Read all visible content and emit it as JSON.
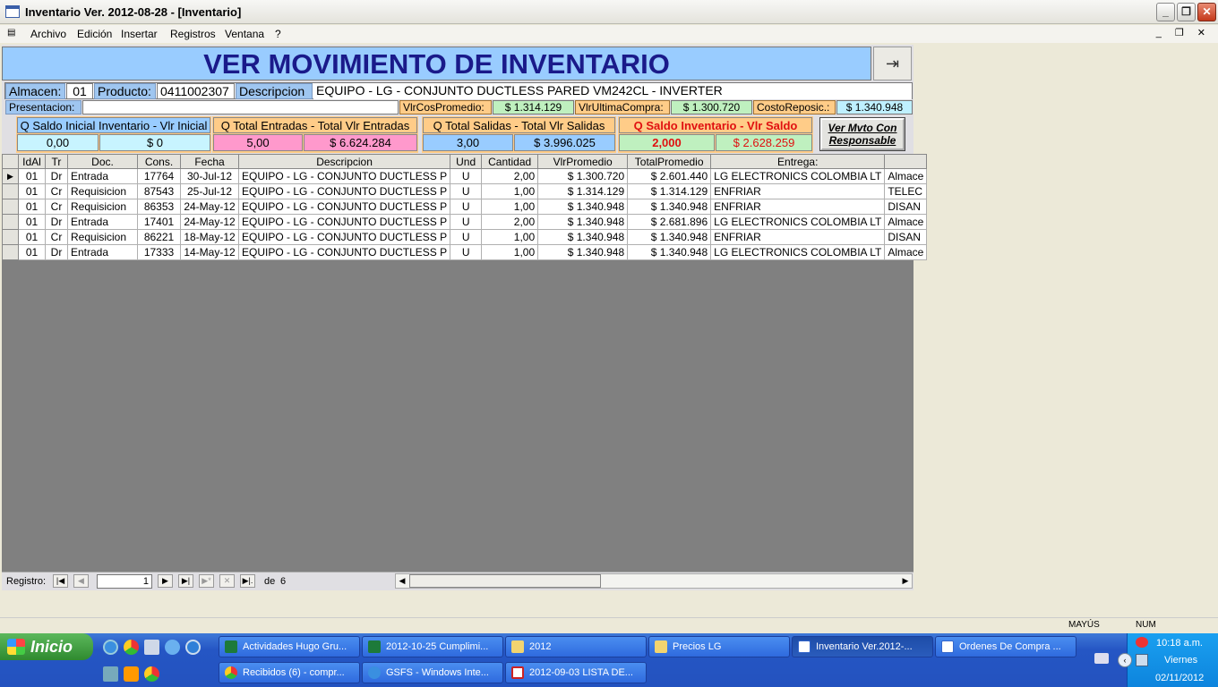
{
  "window": {
    "title": "Inventario Ver. 2012-08-28 - [Inventario]",
    "min": "_",
    "max": "❐",
    "close": "✕"
  },
  "menu": [
    "Archivo",
    "Edición",
    "Insertar",
    "Registros",
    "Ventana",
    "?"
  ],
  "form": {
    "title": "VER MOVIMIENTO DE INVENTARIO",
    "almacen_label": "Almacen:",
    "almacen_value": "01",
    "producto_label": "Producto:",
    "producto_value": "0411002307",
    "descripcion_label": "Descripcion",
    "descripcion_value": "EQUIPO - LG - CONJUNTO DUCTLESS PARED VM242CL - INVERTER",
    "presentacion_label": "Presentacion:",
    "presentacion_value": "",
    "vlrcos_label": "VlrCosPromedio:",
    "vlrcos_value": "$ 1.314.129",
    "vlrultima_label": "VlrUltimaCompra:",
    "vlrultima_value": "$ 1.300.720",
    "costo_label": "CostoReposic.:",
    "costo_value": "$ 1.340.948",
    "saldo_inicial_label": "Q Saldo Inicial Inventario - Vlr Inicial",
    "saldo_inicial_q": "0,00",
    "saldo_inicial_v": "$ 0",
    "entradas_label": "Q Total Entradas - Total Vlr Entradas",
    "entradas_q": "5,00",
    "entradas_v": "$ 6.624.284",
    "salidas_label": "Q Total Salidas - Total Vlr Salidas",
    "salidas_q": "3,00",
    "salidas_v": "$ 3.996.025",
    "saldo_label": "Q Saldo Inventario  - Vlr Saldo",
    "saldo_q": "2,000",
    "saldo_v": "$ 2.628.259",
    "ver_mvto_button": "Ver Mvto Con Responsable"
  },
  "grid": {
    "columns": [
      "IdAl",
      "Tr",
      "Doc.",
      "Cons.",
      "Fecha",
      "Descripcion",
      "Und",
      "Cantidad",
      "VlrPromedio",
      "TotalPromedio",
      "Entrega:",
      ""
    ],
    "rows": [
      [
        "01",
        "Dr",
        "Entrada",
        "17764",
        "30-Jul-12",
        "EQUIPO - LG - CONJUNTO DUCTLESS P",
        "U",
        "2,00",
        "$ 1.300.720",
        "$ 2.601.440",
        "LG ELECTRONICS COLOMBIA LT",
        "Almace"
      ],
      [
        "01",
        "Cr",
        "Requisicion",
        "87543",
        "25-Jul-12",
        "EQUIPO - LG - CONJUNTO DUCTLESS P",
        "U",
        "1,00",
        "$ 1.314.129",
        "$ 1.314.129",
        "ENFRIAR",
        "TELEC"
      ],
      [
        "01",
        "Cr",
        "Requisicion",
        "86353",
        "24-May-12",
        "EQUIPO - LG - CONJUNTO DUCTLESS P",
        "U",
        "1,00",
        "$ 1.340.948",
        "$ 1.340.948",
        "ENFRIAR",
        "DISAN"
      ],
      [
        "01",
        "Dr",
        "Entrada",
        "17401",
        "24-May-12",
        "EQUIPO - LG - CONJUNTO DUCTLESS P",
        "U",
        "2,00",
        "$ 1.340.948",
        "$ 2.681.896",
        "LG ELECTRONICS COLOMBIA LT",
        "Almace"
      ],
      [
        "01",
        "Cr",
        "Requisicion",
        "86221",
        "18-May-12",
        "EQUIPO - LG - CONJUNTO DUCTLESS P",
        "U",
        "1,00",
        "$ 1.340.948",
        "$ 1.340.948",
        "ENFRIAR",
        "DISAN"
      ],
      [
        "01",
        "Dr",
        "Entrada",
        "17333",
        "14-May-12",
        "EQUIPO - LG - CONJUNTO DUCTLESS P",
        "U",
        "1,00",
        "$ 1.340.948",
        "$ 1.340.948",
        "LG ELECTRONICS COLOMBIA LT",
        "Almace"
      ]
    ]
  },
  "navigation": {
    "label": "Registro:",
    "current": "1",
    "of_label": "de",
    "total": "6"
  },
  "status": {
    "mayus": "MAYÚS",
    "num": "NUM"
  },
  "taskbar": {
    "start": "Inicio",
    "tasks": [
      {
        "label": "Actividades Hugo Gru...",
        "icon": "excel-icon"
      },
      {
        "label": "2012-10-25 Cumplimi...",
        "icon": "excel-icon"
      },
      {
        "label": "2012",
        "icon": "folder-icon"
      },
      {
        "label": "Precios LG",
        "icon": "folder-icon"
      },
      {
        "label": "Inventario Ver.2012-...",
        "icon": "access-window-icon"
      },
      {
        "label": "Ordenes De Compra ...",
        "icon": "access-window-icon"
      },
      {
        "label": "Recibidos (6) - compr...",
        "icon": "chrome-icon"
      },
      {
        "label": "GSFS - Windows Inte...",
        "icon": "ie-icon"
      },
      {
        "label": "2012-09-03 LISTA DE...",
        "icon": "pdf-icon"
      }
    ],
    "clock_time": "10:18 a.m.",
    "clock_day": "Viernes",
    "clock_date": "02/11/2012"
  },
  "colors": {
    "banner": "#99ccff",
    "title_text": "#1a1a8a",
    "taskbar": "#2556c4",
    "saldo_text": "#e01010"
  }
}
